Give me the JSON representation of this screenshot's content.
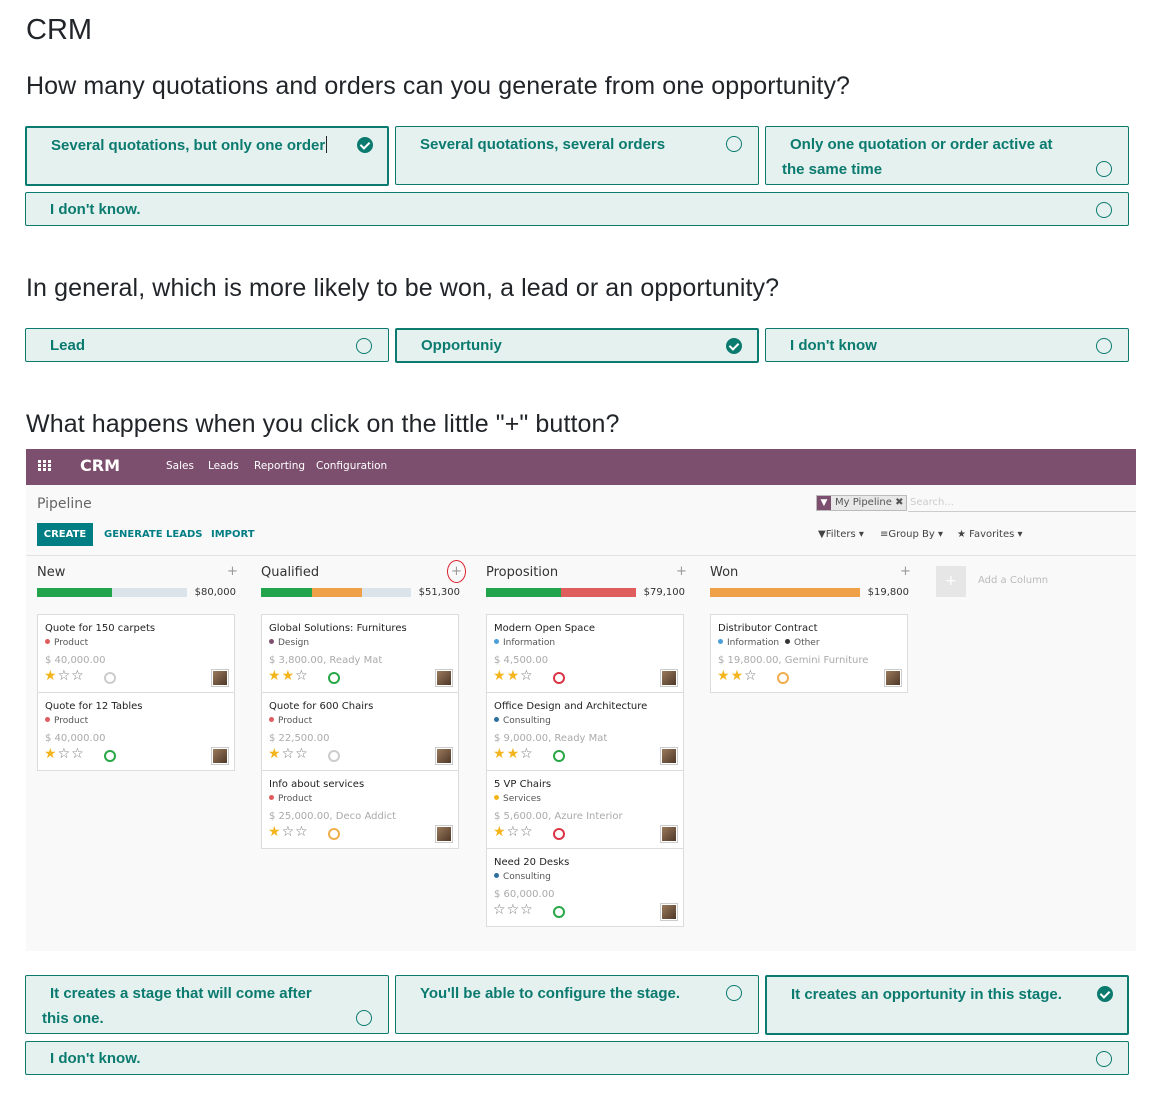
{
  "title": "CRM",
  "questions": [
    {
      "text": "How many quotations and orders can you generate from one opportunity?",
      "options": [
        {
          "label": "Several quotations, but only one order",
          "selected": true
        },
        {
          "label": "Several quotations, several orders",
          "selected": false
        },
        {
          "label": "Only one quotation or order active at the same time",
          "selected": false
        },
        {
          "label": "I don't know.",
          "selected": false
        }
      ]
    },
    {
      "text": "In general, which is more likely to be won, a lead or an opportunity?",
      "options": [
        {
          "label": "Lead",
          "selected": false
        },
        {
          "label": "Opportuniy",
          "selected": true
        },
        {
          "label": "I don't know",
          "selected": false
        }
      ]
    },
    {
      "text": "What happens when you click on the little \"+\" button?",
      "options": [
        {
          "label": "It creates a stage that will come after this one.",
          "selected": false
        },
        {
          "label": "You'll be able to configure the stage.",
          "selected": false
        },
        {
          "label": "It creates an opportunity in this stage.",
          "selected": true
        },
        {
          "label": "I don't know.",
          "selected": false
        }
      ]
    }
  ],
  "screenshot": {
    "brand": "CRM",
    "menu": [
      "Sales",
      "Leads",
      "Reporting",
      "Configuration"
    ],
    "breadcrumb": "Pipeline",
    "buttons": {
      "create": "CREATE",
      "generate": "GENERATE LEADS",
      "import": "IMPORT"
    },
    "facet": "My Pipeline",
    "search_placeholder": "Search...",
    "filters": "Filters",
    "group_by": "Group By",
    "favorites": "Favorites",
    "add_column": "Add a Column",
    "colors": {
      "topbar": "#7c4f6f",
      "accent": "#017e84",
      "green": "#21a44b",
      "orange": "#f0a046",
      "red": "#e05d5d",
      "progress_bg": "#dbe4ea"
    },
    "columns": [
      {
        "title": "New",
        "total": "$80,000",
        "progress": [
          {
            "color": "green",
            "fraction": 0.5
          }
        ],
        "cards": [
          {
            "title": "Quote for 150 carpets",
            "tag": "Product",
            "tag_color": "#e05d5d",
            "amount": "$ 40,000.00",
            "stars": 1,
            "activity": "grey"
          },
          {
            "title": "Quote for 12 Tables",
            "tag": "Product",
            "tag_color": "#e05d5d",
            "amount": "$ 40,000.00",
            "stars": 1,
            "activity": "green"
          }
        ]
      },
      {
        "title": "Qualified",
        "total": "$51,300",
        "progress": [
          {
            "color": "green",
            "fraction": 0.34
          },
          {
            "color": "orange",
            "fraction": 0.33
          }
        ],
        "cards": [
          {
            "title": "Global Solutions: Furnitures",
            "tag": "Design",
            "tag_color": "#7c4f6f",
            "amount": "$ 3,800.00, Ready Mat",
            "stars": 2,
            "activity": "green"
          },
          {
            "title": "Quote for 600 Chairs",
            "tag": "Product",
            "tag_color": "#e05d5d",
            "amount": "$ 22,500.00",
            "stars": 1,
            "activity": "grey"
          },
          {
            "title": "Info about services",
            "tag": "Product",
            "tag_color": "#e05d5d",
            "amount": "$ 25,000.00, Deco Addict",
            "stars": 1,
            "activity": "orange"
          }
        ]
      },
      {
        "title": "Proposition",
        "total": "$79,100",
        "progress": [
          {
            "color": "green",
            "fraction": 0.5
          },
          {
            "color": "red",
            "fraction": 0.5
          }
        ],
        "cards": [
          {
            "title": "Modern Open Space",
            "tag": "Information",
            "tag_color": "#4a9fd8",
            "amount": "$ 4,500.00",
            "stars": 2,
            "activity": "red"
          },
          {
            "title": "Office Design and Architecture",
            "tag": "Consulting",
            "tag_color": "#2e6f9e",
            "amount": "$ 9,000.00, Ready Mat",
            "stars": 2,
            "activity": "green"
          },
          {
            "title": "5 VP Chairs",
            "tag": "Services",
            "tag_color": "#f3b51b",
            "amount": "$ 5,600.00, Azure Interior",
            "stars": 1,
            "activity": "red"
          },
          {
            "title": "Need 20 Desks",
            "tag": "Consulting",
            "tag_color": "#2e6f9e",
            "amount": "$ 60,000.00",
            "stars": 0,
            "activity": "green"
          }
        ]
      },
      {
        "title": "Won",
        "total": "$19,800",
        "progress": [
          {
            "color": "orange",
            "fraction": 1.0
          }
        ],
        "cards": [
          {
            "title": "Distributor Contract",
            "tag": "Information",
            "tag_color": "#4a9fd8",
            "tag2": "Other",
            "tag2_color": "#333333",
            "amount": "$ 19,800.00, Gemini Furniture",
            "stars": 2,
            "activity": "orange"
          }
        ]
      }
    ]
  }
}
